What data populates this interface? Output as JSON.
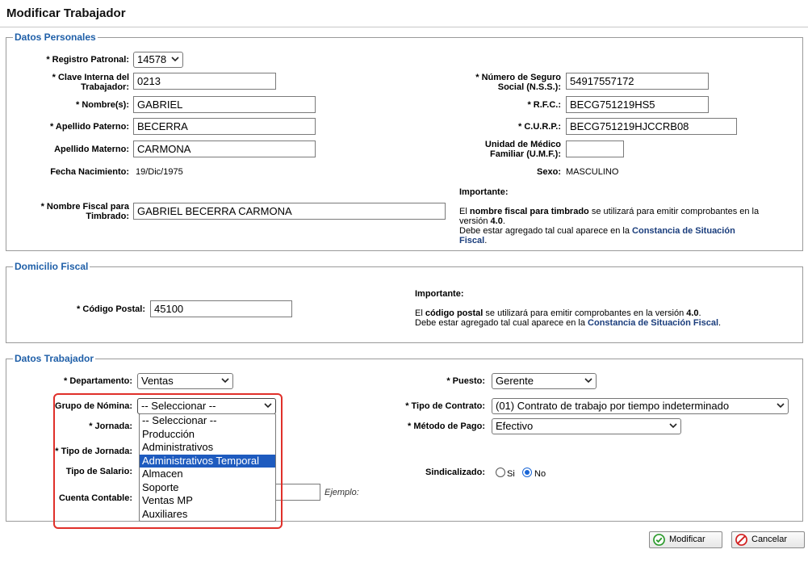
{
  "page": {
    "title": "Modificar Trabajador"
  },
  "personal": {
    "legend": "Datos Personales",
    "registro_patronal": {
      "label": "* Registro Patronal:",
      "value": "14578"
    },
    "clave_interna": {
      "label": "* Clave Interna del Trabajador:",
      "value": "0213"
    },
    "nombres": {
      "label": "* Nombre(s):",
      "value": "GABRIEL"
    },
    "apellido_paterno": {
      "label": "* Apellido Paterno:",
      "value": "BECERRA"
    },
    "apellido_materno": {
      "label": "Apellido Materno:",
      "value": "CARMONA"
    },
    "fecha_nacimiento": {
      "label": "Fecha Nacimiento:",
      "value": "19/Dic/1975"
    },
    "nombre_fiscal": {
      "label": "* Nombre Fiscal para Timbrado:",
      "value": "GABRIEL BECERRA CARMONA"
    },
    "nss": {
      "label": "* Número de Seguro Social (N.S.S.):",
      "value": "54917557172"
    },
    "rfc": {
      "label": "* R.F.C.:",
      "value": "BECG751219HS5"
    },
    "curp": {
      "label": "* C.U.R.P.:",
      "value": "BECG751219HJCCRB08"
    },
    "umf": {
      "label": "Unidad de Médico Familiar (U.M.F.):",
      "value": ""
    },
    "sexo": {
      "label": "Sexo:",
      "value": "MASCULINO"
    },
    "note": {
      "heading": "Importante:",
      "line1_pre": "El ",
      "line1_bold": "nombre fiscal para timbrado",
      "line1_post": " se utilizará para emitir comprobantes en la versión ",
      "version": "4.0",
      "period": ".",
      "line2_pre": "Debe estar agregado tal cual aparece en la ",
      "link": "Constancia de Situación Fiscal",
      "line2_post": "."
    }
  },
  "domicilio": {
    "legend": "Domicilio Fiscal",
    "codigo_postal": {
      "label": "* Código Postal:",
      "value": "45100"
    },
    "note": {
      "heading": "Importante:",
      "line1_pre": "El ",
      "line1_bold": "código postal",
      "line1_post": " se utilizará para emitir comprobantes en la versión ",
      "version": "4.0",
      "period": ".",
      "line2_pre": "Debe estar agregado tal cual aparece en la ",
      "link": "Constancia de Situación Fiscal",
      "line2_post": "."
    }
  },
  "trabajador": {
    "legend": "Datos Trabajador",
    "departamento": {
      "label": "* Departamento:",
      "value": "Ventas"
    },
    "grupo_nomina": {
      "label": "Grupo de Nómina:",
      "value": "-- Seleccionar --",
      "options": [
        "-- Seleccionar --",
        "Producción",
        "Administrativos",
        "Administrativos Temporal",
        "Almacen",
        "Soporte",
        "Ventas MP",
        "Auxiliares"
      ],
      "highlighted_index": 3
    },
    "jornada": {
      "label": "* Jornada:"
    },
    "tipo_jornada": {
      "label": "* Tipo de Jornada:"
    },
    "tipo_salario": {
      "label": "Tipo de Salario:"
    },
    "cuenta_contable": {
      "label": "Cuenta Contable:",
      "value": "",
      "hint": "Ejemplo:"
    },
    "puesto": {
      "label": "* Puesto:",
      "value": "Gerente"
    },
    "tipo_contrato": {
      "label": "* Tipo de Contrato:",
      "value": "(01) Contrato de trabajo por tiempo indeterminado"
    },
    "metodo_pago": {
      "label": "* Método de Pago:",
      "value": "Efectivo"
    },
    "sindicalizado": {
      "label": "Sindicalizado:",
      "opt_si": "Si",
      "opt_no": "No",
      "selected": "No"
    }
  },
  "actions": {
    "modificar": "Modificar",
    "cancelar": "Cancelar"
  },
  "colors": {
    "legend": "#1f5fa8",
    "highlight_border": "#e0302a",
    "selected_option": "#1e5bbf",
    "link": "#1a3d7c"
  }
}
